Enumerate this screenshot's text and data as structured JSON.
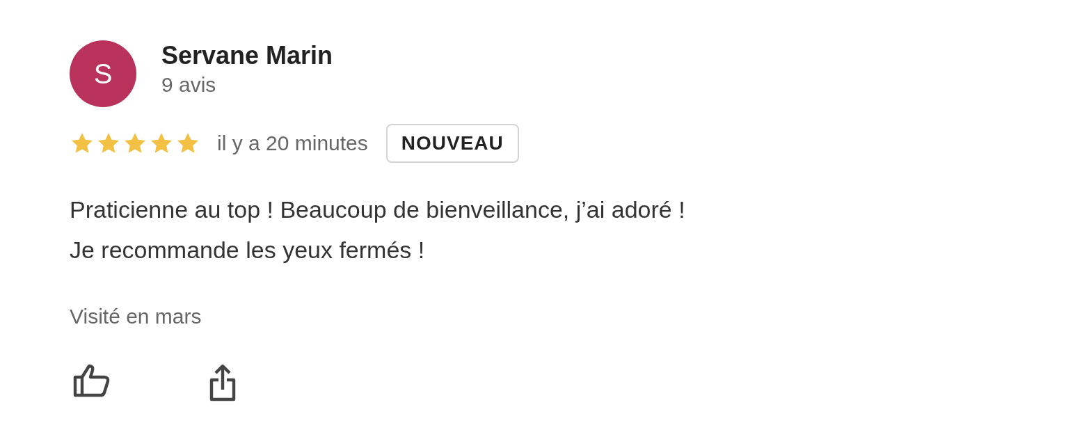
{
  "review": {
    "author": {
      "initial": "S",
      "name": "Servane Marin",
      "count": "9 avis",
      "color": "#b8325c"
    },
    "stars": 5,
    "time": "il y a 20 minutes",
    "badge": "NOUVEAU",
    "text": [
      "Praticienne au top ! Beaucoup de bienveillance, j’ai adoré !",
      "Je recommande les yeux fermés !"
    ],
    "visit": "Visité en mars"
  }
}
